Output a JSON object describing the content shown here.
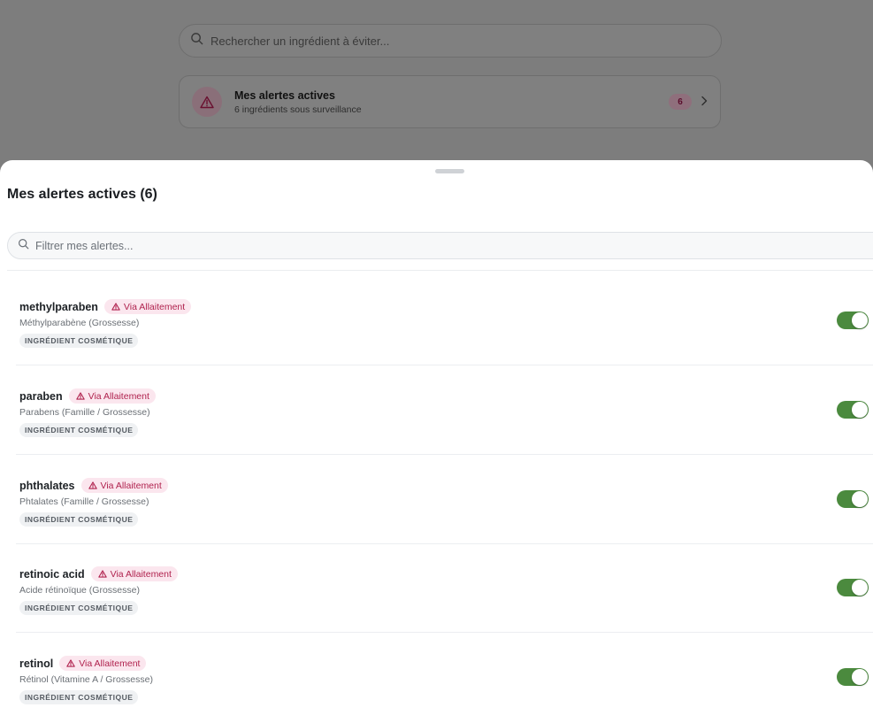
{
  "background": {
    "search_placeholder": "Rechercher un ingrédient à éviter...",
    "alerts_card": {
      "title": "Mes alertes actives",
      "subtitle": "6 ingrédients sous surveillance",
      "count": "6"
    }
  },
  "sheet": {
    "title": "Mes alertes actives (6)",
    "filter_placeholder": "Filtrer mes alertes...",
    "items": [
      {
        "name": "methylparaben",
        "badge": "Via Allaitement",
        "desc": "Méthylparabène (Grossesse)",
        "category": "INGRÉDIENT COSMÉTIQUE",
        "enabled": true
      },
      {
        "name": "paraben",
        "badge": "Via Allaitement",
        "desc": "Parabens (Famille / Grossesse)",
        "category": "INGRÉDIENT COSMÉTIQUE",
        "enabled": true
      },
      {
        "name": "phthalates",
        "badge": "Via Allaitement",
        "desc": "Phtalates (Famille / Grossesse)",
        "category": "INGRÉDIENT COSMÉTIQUE",
        "enabled": true
      },
      {
        "name": "retinoic acid",
        "badge": "Via Allaitement",
        "desc": "Acide rétinoïque (Grossesse)",
        "category": "INGRÉDIENT COSMÉTIQUE",
        "enabled": true
      },
      {
        "name": "retinol",
        "badge": "Via Allaitement",
        "desc": "Rétinol (Vitamine A / Grossesse)",
        "category": "INGRÉDIENT COSMÉTIQUE",
        "enabled": true
      }
    ]
  },
  "colors": {
    "accent_pink": "#b0224e",
    "toggle_on": "#4b8a3e"
  },
  "icons": {
    "search": "search-icon",
    "warning": "warning-triangle-icon",
    "chevron": "chevron-right-icon"
  }
}
